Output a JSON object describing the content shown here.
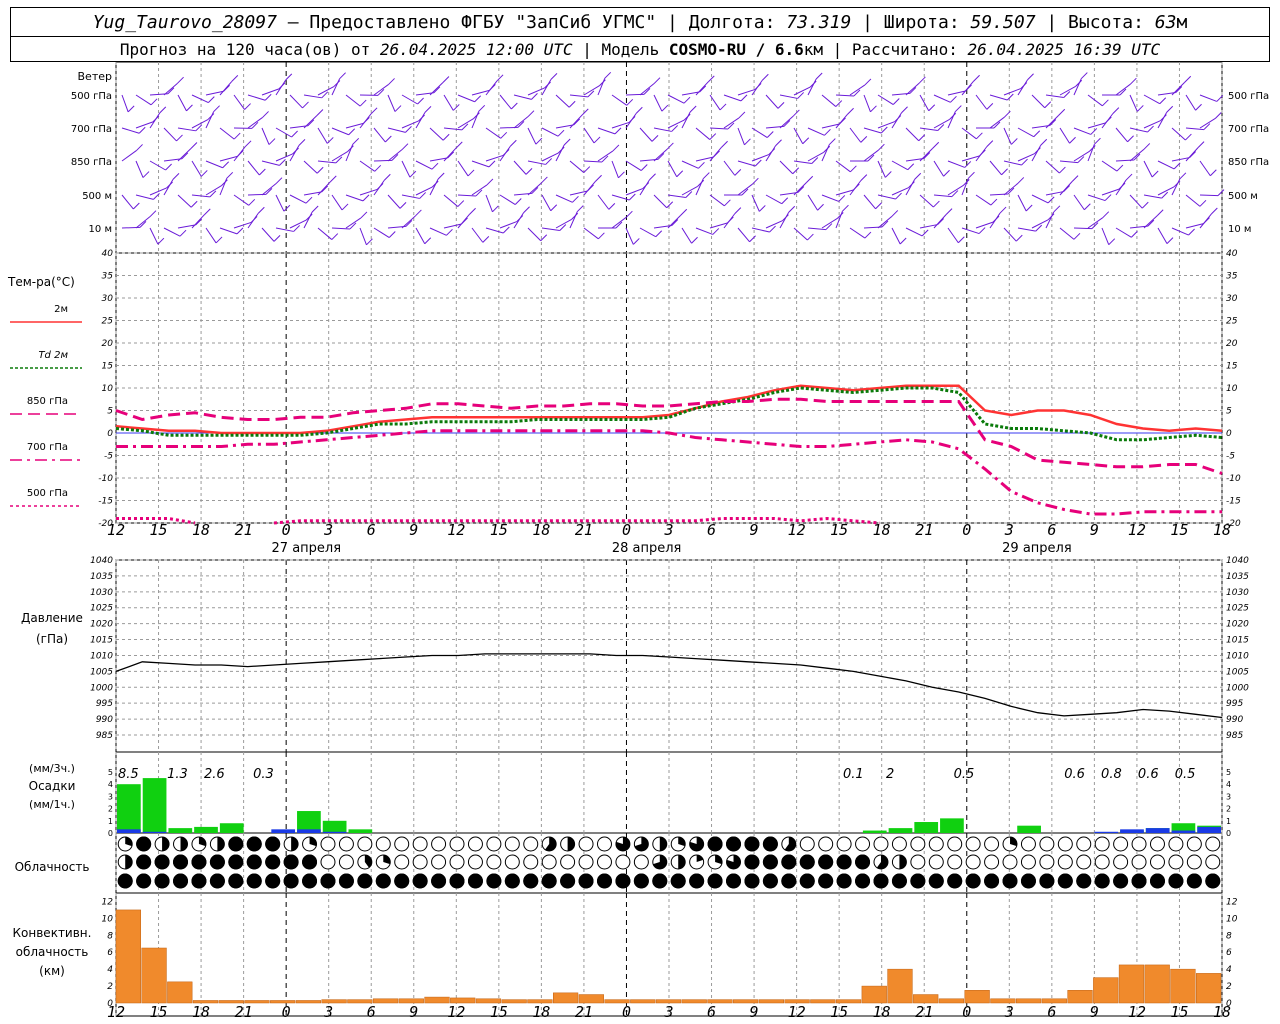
{
  "header": {
    "station": "Yug_Taurovo_28097",
    "provider_text": " – Предоставлено ФГБУ \"ЗапСиб УГМС\" | Долгота: ",
    "lon": "73.319",
    "lat_label": " | Широта: ",
    "lat": "59.507",
    "alt_label": " | Высота: ",
    "alt": "63",
    "alt_unit": "м",
    "forecast_label": "Прогноз на 120 часа(ов) от ",
    "forecast_date": "26.04.2025 12:00 UTC",
    "model_label": " | Модель ",
    "model": "COSMO-RU / 6.6",
    "model_unit": "км",
    "calc_label": " | Рассчитано: ",
    "calc_date": "26.04.2025 16:39 UTC"
  },
  "colors": {
    "wind": "#6a1bd8",
    "t2m": "#ff3333",
    "td": "#0a7a0a",
    "lev850": "#e6007a",
    "lev700": "#e6007a",
    "lev500": "#e6007a",
    "precip3": "#10d010",
    "precip1": "#1a3ae6",
    "conv": "#f08a2c",
    "grid": "#9a9a9a",
    "pressure": "#000000"
  },
  "wind_panel": {
    "title": "Ветер",
    "levels": [
      "500 гПа",
      "700 гПа",
      "850 гПа",
      "500 м",
      "10 м"
    ]
  },
  "time_axis": {
    "tick_labels": [
      "12",
      "15",
      "18",
      "21",
      "0",
      "3",
      "6",
      "9",
      "12",
      "15",
      "18",
      "21",
      "0",
      "3",
      "6",
      "9",
      "12",
      "15",
      "18",
      "21",
      "0",
      "3",
      "6",
      "9",
      "12",
      "15",
      "18"
    ],
    "day_labels": [
      "27 апреля",
      "28 апреля",
      "29 апреля"
    ]
  },
  "chart_data": [
    {
      "type": "line",
      "title": "Тем-ра(°C)",
      "ylim": [
        -20,
        40
      ],
      "yticks": [
        -20,
        -15,
        -10,
        -5,
        0,
        5,
        10,
        15,
        20,
        25,
        30,
        35,
        40
      ],
      "x_hours": "0..78 step 3",
      "legend": [
        {
          "key": "t2m",
          "label": "2м"
        },
        {
          "key": "td",
          "label": "Td  2м"
        },
        {
          "key": "lev850",
          "label": "850 гПа"
        },
        {
          "key": "lev700",
          "label": "700 гПа"
        },
        {
          "key": "lev500",
          "label": "500 гПа"
        }
      ],
      "series": [
        {
          "name": "2м",
          "key": "t2m",
          "values": [
            1.5,
            1,
            0.5,
            0.5,
            0,
            0,
            0,
            0,
            0.5,
            1.5,
            2.5,
            3,
            3.5,
            3.5,
            3.5,
            3.5,
            3.5,
            3.5,
            3.5,
            3.5,
            3.5,
            4,
            5.5,
            7,
            8,
            9.5,
            10.5,
            10,
            9.5,
            10,
            10.5,
            10.5,
            10.5,
            5,
            4,
            5,
            5,
            4,
            2,
            1,
            0.5,
            1,
            0.5
          ]
        },
        {
          "name": "Td 2м",
          "key": "td",
          "values": [
            1,
            0.5,
            -0.5,
            -0.5,
            -0.5,
            -0.5,
            -0.5,
            -0.5,
            0,
            1,
            2,
            2,
            2.5,
            2.5,
            2.5,
            2.5,
            3,
            3,
            3,
            3,
            3,
            3.5,
            5.5,
            6.5,
            7.5,
            9,
            10,
            9.5,
            9,
            9.5,
            10,
            10,
            9,
            2,
            1,
            1,
            0.5,
            0,
            -1.5,
            -1.5,
            -1,
            -0.5,
            -1
          ]
        },
        {
          "name": "850 гПа",
          "key": "lev850",
          "values": [
            5,
            3,
            4,
            4.5,
            3.5,
            3,
            3,
            3.5,
            3.5,
            4.5,
            5,
            5.5,
            6.5,
            6.5,
            6,
            5.5,
            6,
            6,
            6.5,
            6.5,
            6,
            6,
            6.5,
            7,
            7,
            7.5,
            7.5,
            7,
            7,
            7,
            7,
            7,
            7,
            -1.5,
            -3,
            -6,
            -6.5,
            -7,
            -7.5,
            -7.5,
            -7,
            -7,
            -9
          ]
        },
        {
          "name": "700 гПа",
          "key": "lev700",
          "values": [
            -3,
            -3,
            -3,
            -3,
            -3,
            -2.5,
            -2.5,
            -2,
            -1.5,
            -1,
            -0.5,
            0,
            0.5,
            0.5,
            0.5,
            0.5,
            0.5,
            0.5,
            0.5,
            0.5,
            0.5,
            0,
            -1,
            -1.5,
            -2,
            -2.5,
            -3,
            -3,
            -2.5,
            -2,
            -1.5,
            -2,
            -3.5,
            -8,
            -13,
            -15.5,
            -17,
            -18,
            -18,
            -17.5,
            -17.5,
            -17.5,
            -17.5
          ]
        },
        {
          "name": "500 гПа",
          "key": "lev500",
          "values": [
            -19,
            -19,
            -19,
            -20,
            null,
            null,
            -20,
            -19.5,
            -19.5,
            -19.5,
            -19.5,
            -19.5,
            -19.5,
            -19.5,
            -19.5,
            -19.5,
            -19.5,
            -19.5,
            -19.5,
            -19.5,
            -19.5,
            -19.5,
            -19.5,
            -19,
            -19,
            -19,
            -19.5,
            -19,
            -19.5,
            -20,
            null,
            null,
            null,
            null,
            null,
            null,
            null,
            null,
            null,
            null,
            null,
            null,
            null
          ]
        }
      ]
    },
    {
      "type": "line",
      "title": "Давление",
      "unit": "(гПа)",
      "ylim": [
        985,
        1040
      ],
      "yticks": [
        985,
        990,
        995,
        1000,
        1005,
        1010,
        1015,
        1020,
        1025,
        1030,
        1035,
        1040
      ],
      "series": [
        {
          "name": "Давление",
          "key": "pressure",
          "x_hours": [
            0,
            1,
            2,
            3,
            4,
            5,
            6,
            7,
            8,
            9,
            10,
            11,
            12,
            13,
            14,
            15,
            16,
            17,
            18,
            19,
            20,
            21,
            22,
            23,
            24,
            25,
            26,
            27,
            28,
            29,
            30,
            31,
            32,
            33,
            34,
            35,
            36,
            37,
            38,
            39,
            40,
            41,
            42
          ],
          "values": [
            1005,
            1008,
            1007.5,
            1007,
            1007,
            1006.5,
            1007,
            1007.5,
            1008,
            1008.5,
            1009,
            1009.5,
            1010,
            1010,
            1010.5,
            1010.5,
            1010.5,
            1010.5,
            1010.5,
            1010,
            1010,
            1009.5,
            1009,
            1008.5,
            1008,
            1007.5,
            1007,
            1006,
            1005,
            1003.5,
            1002,
            1000,
            998.5,
            996.5,
            994,
            992,
            991,
            991.5,
            992,
            993,
            992.5,
            991.5,
            990.5
          ]
        }
      ]
    },
    {
      "type": "bar",
      "title": "Осадки",
      "units": [
        "(мм/3ч.)",
        "(мм/1ч.)"
      ],
      "ylim": [
        0,
        5
      ],
      "yticks": [
        0,
        1,
        2,
        3,
        4,
        5
      ],
      "labels": [
        {
          "hour": 1,
          "text": "8.5"
        },
        {
          "hour": 5,
          "text": "1.3"
        },
        {
          "hour": 8,
          "text": "2.6"
        },
        {
          "hour": 12,
          "text": "0.3"
        },
        {
          "hour": 60,
          "text": "0.1"
        },
        {
          "hour": 63,
          "text": "2"
        },
        {
          "hour": 69,
          "text": "0.5"
        },
        {
          "hour": 78,
          "text": "0.6"
        },
        {
          "hour": 81,
          "text": "0.8"
        },
        {
          "hour": 84,
          "text": "0.6"
        },
        {
          "hour": 87,
          "text": "0.5"
        }
      ],
      "series": [
        {
          "name": "мм/3ч.",
          "key": "precip3",
          "x_hours": [
            0,
            1,
            2,
            3,
            4,
            5,
            6,
            7,
            8,
            9,
            10,
            11,
            12,
            13,
            14,
            15,
            16,
            17,
            18,
            19,
            20,
            21,
            22,
            23,
            24,
            25,
            26,
            27,
            28,
            29,
            30,
            31,
            32,
            33,
            34,
            35,
            36,
            37,
            38,
            39,
            40,
            41,
            42
          ],
          "values": [
            4,
            4.5,
            0.4,
            0.5,
            0.8,
            0,
            0,
            1.8,
            1,
            0.3,
            0,
            0,
            0,
            0,
            0,
            0,
            0,
            0,
            0,
            0,
            0,
            0,
            0,
            0,
            0,
            0,
            0,
            0,
            0,
            0.2,
            0.4,
            0.9,
            1.2,
            0,
            0,
            0.6,
            0,
            0,
            0,
            0.2,
            0.4,
            0.8,
            0.6
          ]
        },
        {
          "name": "мм/1ч.",
          "key": "precip1",
          "values": [
            0.3,
            0.1,
            0,
            0,
            0,
            0,
            0.3,
            0.3,
            0.1,
            0,
            0,
            0,
            0,
            0,
            0,
            0,
            0,
            0,
            0,
            0,
            0,
            0,
            0,
            0,
            0,
            0,
            0,
            0,
            0,
            0,
            0,
            0,
            0,
            0,
            0,
            0,
            0,
            0,
            0.1,
            0.3,
            0.4,
            0.2,
            0.5
          ]
        }
      ]
    },
    {
      "type": "bar",
      "title": "Конвективн.",
      "title2": "облачность",
      "unit": "(км)",
      "ylim": [
        0,
        13
      ],
      "yticks": [
        0,
        2,
        4,
        6,
        8,
        10,
        12
      ],
      "series": [
        {
          "name": "Конвективная облачность",
          "key": "conv",
          "x_hours": [
            0,
            1,
            2,
            3,
            4,
            5,
            6,
            7,
            8,
            9,
            10,
            11,
            12,
            13,
            14,
            15,
            16,
            17,
            18,
            19,
            20,
            21,
            22,
            23,
            24,
            25,
            26,
            27,
            28,
            29,
            30,
            31,
            32,
            33,
            34,
            35,
            36,
            37,
            38,
            39,
            40,
            41,
            42
          ],
          "values": [
            11,
            6.5,
            2.5,
            0.3,
            0.3,
            0.3,
            0.3,
            0.3,
            0.4,
            0.4,
            0.5,
            0.5,
            0.7,
            0.6,
            0.5,
            0.4,
            0.4,
            1.2,
            1,
            0.4,
            0.4,
            0.4,
            0.4,
            0.4,
            0.4,
            0.4,
            0.4,
            0.4,
            0.4,
            2,
            4,
            1,
            0.5,
            1.5,
            0.5,
            0.5,
            0.5,
            1.5,
            3,
            4.5,
            4.5,
            4,
            3.5
          ]
        }
      ]
    }
  ],
  "cloud_panel": {
    "title": "Облачность",
    "rows": [
      {
        "name": "upper",
        "values": [
          0.3,
          1,
          0.5,
          0.5,
          0.3,
          0.5,
          1,
          1,
          1,
          0.5,
          0.3,
          0,
          0,
          0,
          0,
          0,
          0,
          0,
          0,
          0,
          0,
          0,
          0,
          0.6,
          0.5,
          0,
          0,
          0.8,
          0.7,
          0.5,
          0.3,
          0.8,
          1,
          1,
          1,
          1,
          0.6,
          0,
          0,
          0,
          0,
          0,
          0,
          0,
          0,
          0,
          0,
          0,
          0.3,
          0,
          0,
          0,
          0,
          0,
          0,
          0,
          0,
          0,
          0,
          0
        ]
      },
      {
        "name": "middle",
        "values": [
          0.5,
          1,
          1,
          1,
          1,
          1,
          1,
          1,
          1,
          1,
          1,
          0,
          0,
          0.4,
          0.3,
          0,
          0,
          0,
          0,
          0,
          0,
          0,
          0,
          0,
          0,
          0,
          0,
          0,
          0,
          0.7,
          0.5,
          0.2,
          0.3,
          0.8,
          1,
          1,
          1,
          1,
          1,
          1,
          1,
          0.6,
          0.5,
          0,
          0,
          0,
          0,
          0,
          0,
          0,
          0,
          0,
          0,
          0,
          0,
          0,
          0,
          0,
          0,
          0
        ]
      },
      {
        "name": "lower",
        "values": [
          1,
          1,
          1,
          1,
          1,
          1,
          1,
          1,
          1,
          1,
          1,
          1,
          1,
          1,
          1,
          1,
          1,
          1,
          1,
          1,
          1,
          1,
          1,
          1,
          1,
          1,
          1,
          1,
          1,
          1,
          1,
          1,
          1,
          1,
          1,
          1,
          1,
          1,
          1,
          1,
          1,
          1,
          1,
          1,
          1,
          1,
          1,
          1,
          1,
          1,
          1,
          1,
          1,
          1,
          1,
          1,
          1,
          1,
          1,
          1
        ]
      }
    ]
  }
}
